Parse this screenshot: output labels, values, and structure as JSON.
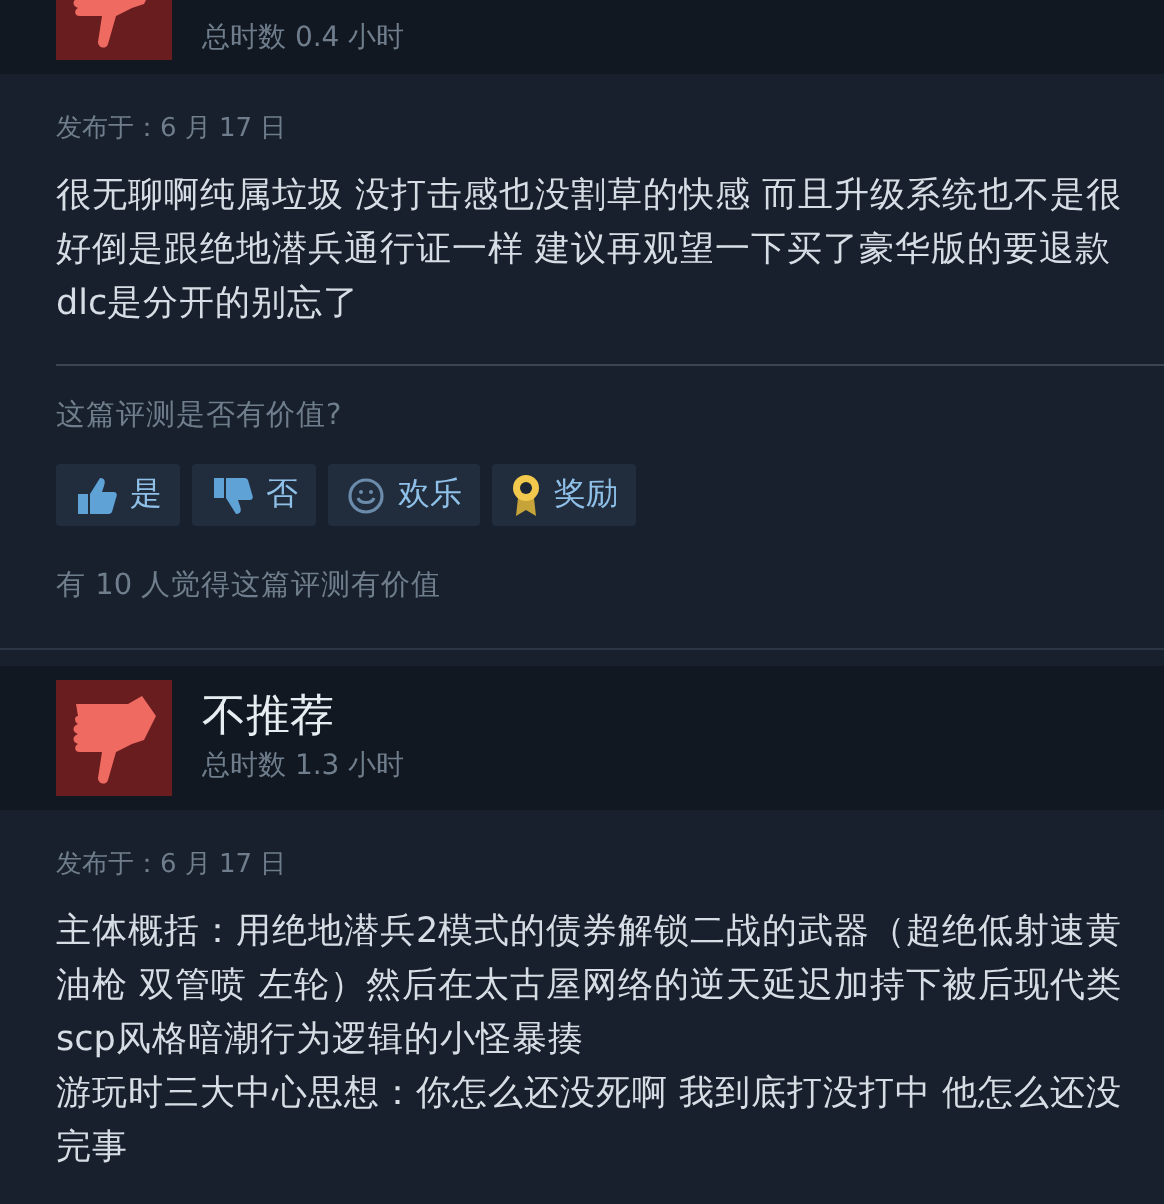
{
  "reviews": [
    {
      "hours": "总时数 0.4 小时",
      "posted": "发布于：6 月 17 日",
      "body": [
        "很无聊啊纯属垃圾 没打击感也没割草的快感 而且升级系统也不是很",
        "好倒是跟绝地潜兵通行证一样 建议再观望一下买了豪华版的要退款",
        "dlc是分开的别忘了"
      ],
      "question": "这篇评测是否有价值?",
      "buttons": [
        {
          "kind": "yes",
          "label": "是"
        },
        {
          "kind": "no",
          "label": "否"
        },
        {
          "kind": "funny",
          "label": "欢乐"
        },
        {
          "kind": "award",
          "label": "奖励"
        }
      ],
      "helpful": "有 10 人觉得这篇评测有价值"
    },
    {
      "title": "不推荐",
      "hours": "总时数 1.3 小时",
      "posted": "发布于：6 月 17 日",
      "body": [
        "主体概括：用绝地潜兵2模式的债券解锁二战的武器（超绝低射速黄",
        "油枪 双管喷 左轮）然后在太古屋网络的逆天延迟加持下被后现代类",
        "scp风格暗潮行为逻辑的小怪暴揍",
        "游玩时三大中心思想：你怎么还没死啊 我到底打没打中 他怎么还没",
        "完事"
      ]
    }
  ]
}
